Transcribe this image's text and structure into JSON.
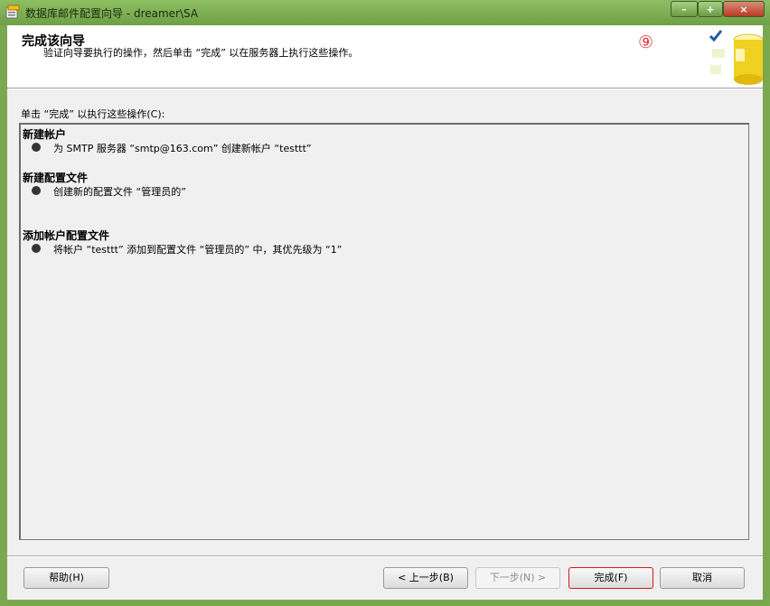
{
  "window": {
    "title": "数据库邮件配置向导 - dreamer\\SA",
    "controls": {
      "minimize": "–",
      "maximize": "+",
      "close": "×"
    }
  },
  "header": {
    "title": "完成该向导",
    "description": "验证向导要执行的操作，然后单击 “完成” 以在服务器上执行这些操作。",
    "step_marker": "⑨",
    "icon": "database-checkmark-icon"
  },
  "actions": {
    "label": "单击 “完成” 以执行这些操作(C):",
    "sections": [
      {
        "title": "新建帐户",
        "items": [
          "为 SMTP 服务器 “smtp@163.com” 创建新帐户 “testtt”"
        ]
      },
      {
        "title": "新建配置文件",
        "items": [
          "创建新的配置文件 “管理员的”"
        ]
      },
      {
        "title": "添加帐户配置文件",
        "items": [
          "将帐户 “testtt” 添加到配置文件 “管理员的” 中，其优先级为 “1”"
        ]
      }
    ]
  },
  "buttons": {
    "help": "帮助(H)",
    "back": "< 上一步(B)",
    "next": "下一步(N) >",
    "finish": "完成(F)",
    "cancel": "取消"
  },
  "colors": {
    "titlebar": "#7aa84f",
    "step_marker": "#e03a3a",
    "focus": "#d01a1a"
  }
}
